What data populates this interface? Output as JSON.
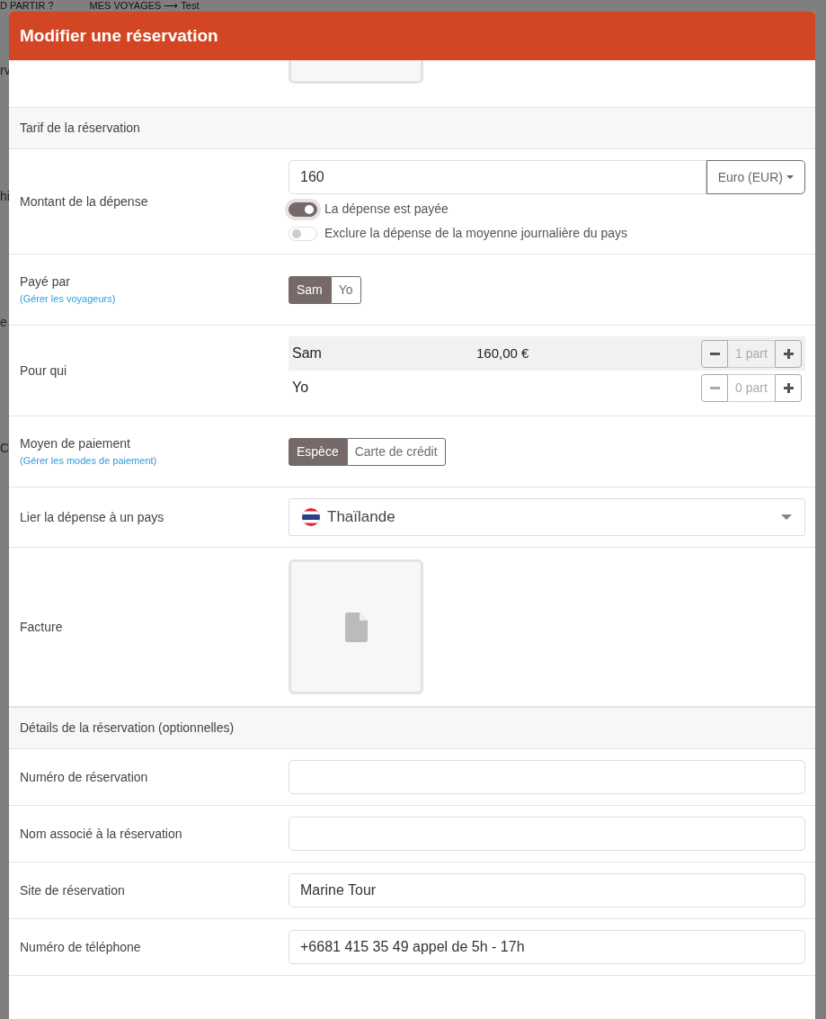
{
  "backdrop": {
    "nav": [
      "D PARTIR ?",
      "MES VOYAGES ⟶ Test"
    ],
    "fragments": [
      "rv",
      "hi",
      "e",
      "C"
    ]
  },
  "modal": {
    "title": "Modifier une réservation"
  },
  "sections": [
    {
      "title": "Tarif de la réservation",
      "rows": [
        {
          "kind": "amount",
          "label": "Montant de la dépense",
          "value": "160",
          "currency": "Euro (EUR)",
          "toggles": [
            {
              "label": "La dépense est payée",
              "on": true
            },
            {
              "label": "Exclure la dépense de la moyenne journalière du pays",
              "on": false
            }
          ]
        },
        {
          "kind": "segmented",
          "label": "Payé par",
          "link": "(Gérer les voyageurs)",
          "options": [
            {
              "label": "Sam",
              "selected": true
            },
            {
              "label": "Yo",
              "selected": false
            }
          ]
        },
        {
          "kind": "shares",
          "label": "Pour qui",
          "people": [
            {
              "name": "Sam",
              "amount": "160,00 €",
              "part": "1 part",
              "selected": true
            },
            {
              "name": "Yo",
              "part": "0 part",
              "selected": false
            }
          ]
        },
        {
          "kind": "segmented",
          "label": "Moyen de paiement",
          "link": "(Gérer les modes de paiement)",
          "options": [
            {
              "label": "Espèce",
              "selected": true
            },
            {
              "label": "Carte de crédit",
              "selected": false
            }
          ]
        },
        {
          "kind": "select",
          "label": "Lier la dépense à un pays",
          "value": "Thaïlande"
        },
        {
          "kind": "file",
          "label": "Facture"
        }
      ]
    },
    {
      "title": "Détails de la réservation (optionnelles)",
      "rows": [
        {
          "kind": "text",
          "label": "Numéro de réservation"
        },
        {
          "kind": "text",
          "label": "Nom associé à la réservation"
        },
        {
          "kind": "text",
          "label": "Site de réservation",
          "value": "Marine Tour"
        },
        {
          "kind": "text",
          "label": "Numéro de téléphone",
          "value": "+6681 415 35 49 appel de 5h - 17h"
        }
      ]
    }
  ]
}
